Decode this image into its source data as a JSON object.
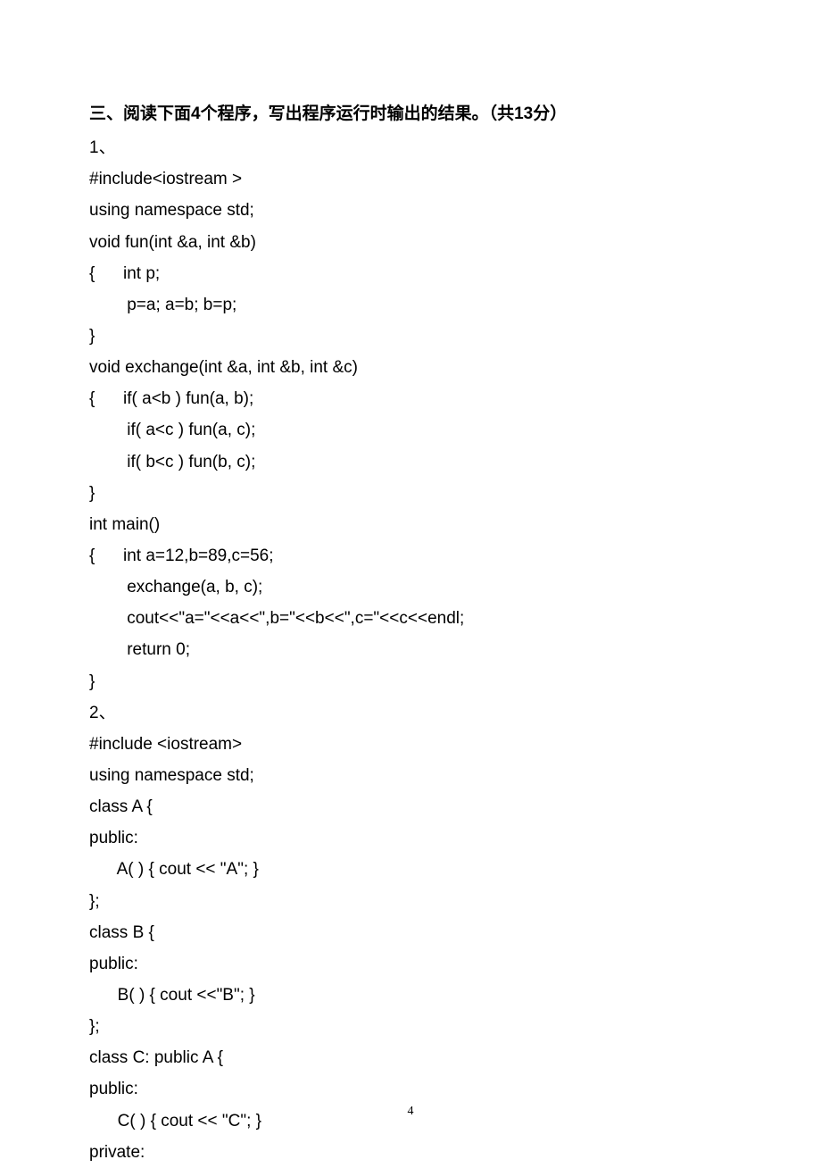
{
  "heading": "三、阅读下面4个程序，写出程序运行时输出的结果。（共13分）",
  "lines": [
    "1、",
    "#include<iostream >",
    "using namespace std;",
    "void fun(int &a, int &b)",
    "{      int p;",
    "        p=a; a=b; b=p;",
    "}",
    "void exchange(int &a, int &b, int &c)",
    "{      if( a<b ) fun(a, b);",
    "        if( a<c ) fun(a, c);",
    "        if( b<c ) fun(b, c);",
    "}",
    "int main()",
    "{      int a=12,b=89,c=56;",
    "        exchange(a, b, c);",
    "        cout<<\"a=\"<<a<<\",b=\"<<b<<\",c=\"<<c<<endl;",
    "        return 0;",
    "}",
    "2、",
    "#include <iostream>",
    "using namespace std;",
    "class A {",
    "public:",
    "      A( ) { cout << \"A\"; }",
    "};",
    "class B {",
    "public:",
    "      B( ) { cout <<\"B\"; }",
    "};",
    "class C: public A {",
    "public:",
    "      C( ) { cout << \"C\"; }",
    "private:"
  ],
  "pageNumber": "4"
}
